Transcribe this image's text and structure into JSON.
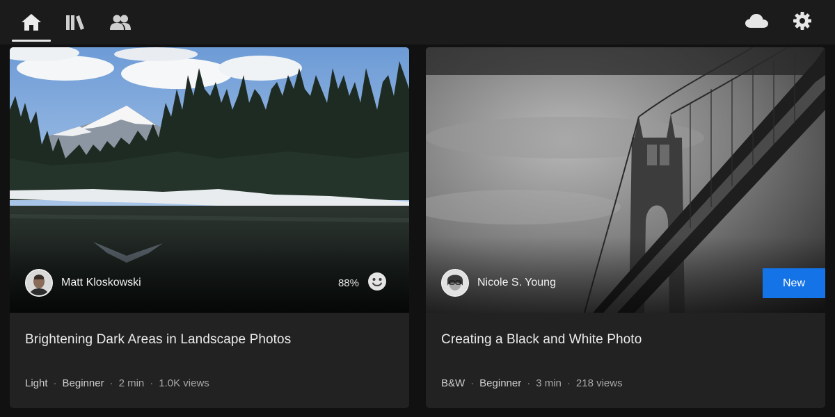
{
  "nav": {
    "tabs": [
      {
        "name": "home",
        "icon": "home-icon",
        "active": true
      },
      {
        "name": "learn",
        "icon": "library-icon",
        "active": false
      },
      {
        "name": "community",
        "icon": "people-icon",
        "active": false
      }
    ],
    "right": [
      {
        "name": "cloud",
        "icon": "cloud-icon"
      },
      {
        "name": "settings",
        "icon": "gear-icon"
      }
    ]
  },
  "colors": {
    "background": "#111111",
    "topbar": "#1b1b1b",
    "card": "#222222",
    "accent": "#1473e6"
  },
  "cards": [
    {
      "author": "Matt Kloskowski",
      "rating": "88%",
      "rating_icon": "smiley-icon",
      "title": "Brightening Dark Areas in Landscape Photos",
      "meta": {
        "tag": "Light",
        "level": "Beginner",
        "duration": "2 min",
        "views": "1.0K views"
      }
    },
    {
      "author": "Nicole S. Young",
      "badge": "New",
      "title": "Creating a Black and White Photo",
      "meta": {
        "tag": "B&W",
        "level": "Beginner",
        "duration": "3 min",
        "views": "218 views"
      }
    }
  ],
  "separator": "·"
}
